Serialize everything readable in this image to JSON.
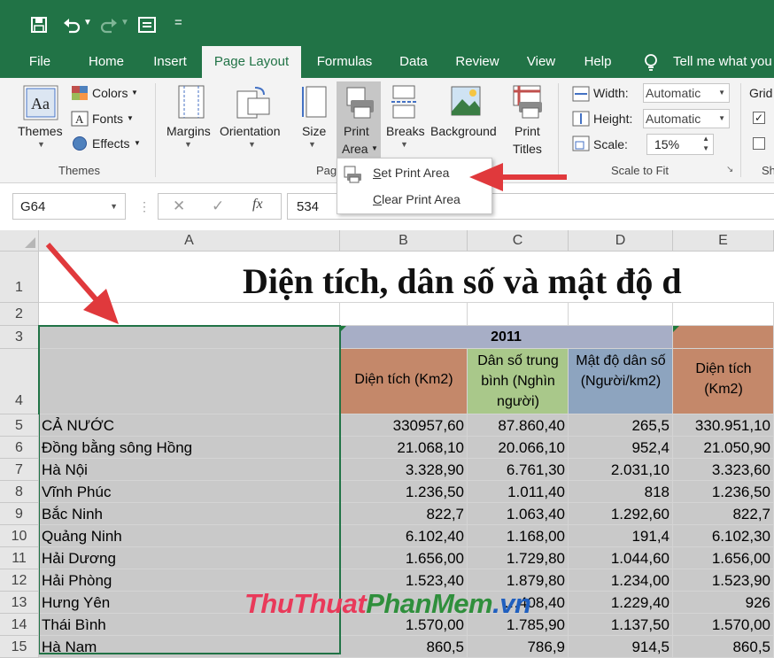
{
  "qat": {
    "save": "save-icon",
    "undo": "undo-icon",
    "redo": "redo-icon",
    "form": "form-icon",
    "customize": "="
  },
  "tabs": [
    "File",
    "Home",
    "Insert",
    "Page Layout",
    "Formulas",
    "Data",
    "Review",
    "View",
    "Help"
  ],
  "tell_me": "Tell me what you",
  "ribbon": {
    "themes": {
      "label": "Themes",
      "colors": "Colors",
      "fonts": "Fonts",
      "effects": "Effects",
      "group": "Themes"
    },
    "page_setup": {
      "margins": "Margins",
      "orientation": "Orientation",
      "size": "Size",
      "print_area_1": "Print",
      "print_area_2": "Area",
      "breaks": "Breaks",
      "background": "Background",
      "print_titles_1": "Print",
      "print_titles_2": "Titles",
      "group": "Pag"
    },
    "scale": {
      "width_label": "Width:",
      "width_value": "Automatic",
      "height_label": "Height:",
      "height_value": "Automatic",
      "scale_label": "Scale:",
      "scale_value": "15%",
      "group": "Scale to Fit"
    },
    "sheet_options": {
      "gridlines": "Grid",
      "group": "Sh"
    }
  },
  "print_area_menu": [
    {
      "label": "Set Print Area",
      "accel": "S"
    },
    {
      "label": "Clear Print Area",
      "accel": "C"
    }
  ],
  "formula_bar": {
    "name_box": "G64",
    "fx": "fx",
    "value": "534"
  },
  "columns": [
    "A",
    "B",
    "C",
    "D",
    "E"
  ],
  "title_row": "Diện tích, dân số và mật độ d",
  "year_header": "2011",
  "sub_headers": [
    "Diện tích (Km2)",
    "Dân số trung bình (Nghìn người)",
    "Mật độ dân số (Người/km2)",
    "Diện tích (Km2)"
  ],
  "row_numbers": [
    "1",
    "2",
    "3",
    "4",
    "5",
    "6",
    "7",
    "8",
    "9",
    "10",
    "11",
    "12",
    "13",
    "14",
    "15"
  ],
  "rows": [
    {
      "name": "CẢ NƯỚC",
      "b": "330957,60",
      "c": "87.860,40",
      "d": "265,5",
      "e": "330.951,10"
    },
    {
      "name": "Đồng bằng sông Hồng",
      "b": "21.068,10",
      "c": "20.066,10",
      "d": "952,4",
      "e": "21.050,90"
    },
    {
      "name": "Hà Nội",
      "b": "3.328,90",
      "c": "6.761,30",
      "d": "2.031,10",
      "e": "3.323,60"
    },
    {
      "name": "Vĩnh Phúc",
      "b": "1.236,50",
      "c": "1.011,40",
      "d": "818",
      "e": "1.236,50"
    },
    {
      "name": "Bắc Ninh",
      "b": "822,7",
      "c": "1.063,40",
      "d": "1.292,60",
      "e": "822,7"
    },
    {
      "name": "Quảng Ninh",
      "b": "6.102,40",
      "c": "1.168,00",
      "d": "191,4",
      "e": "6.102,30"
    },
    {
      "name": "Hải Dương",
      "b": "1.656,00",
      "c": "1.729,80",
      "d": "1.044,60",
      "e": "1.656,00"
    },
    {
      "name": "Hải Phòng",
      "b": "1.523,40",
      "c": "1.879,80",
      "d": "1.234,00",
      "e": "1.523,90"
    },
    {
      "name": "Hưng Yên",
      "b": "",
      "c": "…408,40",
      "d": "1.229,40",
      "e": "926"
    },
    {
      "name": "Thái Bình",
      "b": "1.570,00",
      "c": "1.785,90",
      "d": "1.137,50",
      "e": "1.570,00"
    },
    {
      "name": "Hà Nam",
      "b": "860,5",
      "c": "786,9",
      "d": "914,5",
      "e": "860,5"
    }
  ],
  "watermark": {
    "part1": "ThuThuat",
    "part2": "PhanMem",
    "part3": ".vn"
  },
  "colors": {
    "excel_green": "#217346",
    "header_orange": "#c4886a",
    "header_green": "#a9c88a",
    "header_blue": "#8da4bf",
    "year_band": "#a7aec6",
    "arrow_red": "#e0393c"
  }
}
